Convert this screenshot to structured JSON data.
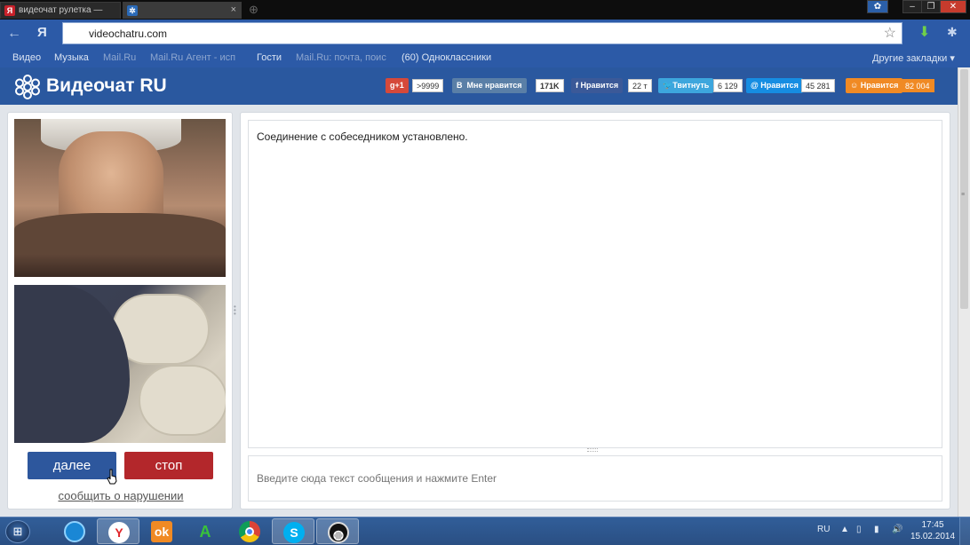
{
  "browser": {
    "tabs": [
      {
        "label": "видеочат рулетка —",
        "active": false
      },
      {
        "label": "",
        "active": true
      }
    ],
    "address": "videochatru.com",
    "yandex_letter": "Я",
    "bookmarks": [
      {
        "label": "Видео",
        "dim": false
      },
      {
        "label": "Музыка",
        "dim": false
      },
      {
        "label": "Mail.Ru",
        "dim": true
      },
      {
        "label": "Mail.Ru Агент - исп",
        "dim": true
      },
      {
        "label": "Гости",
        "dim": false
      },
      {
        "label": "Mail.Ru: почта, поис",
        "dim": true
      },
      {
        "label": "(60) Одноклассники",
        "dim": false
      }
    ],
    "other_bookmarks": "Другие закладки"
  },
  "site": {
    "title": "Видеочат RU",
    "social": [
      {
        "label": "g+1",
        "count": ">9999",
        "color": "#d5493a"
      },
      {
        "label": "Мне нравится",
        "prefix": "В",
        "count": "171K",
        "color": "#5a7fa7"
      },
      {
        "label": "Нравится",
        "prefix": "f",
        "count": "22 т",
        "color": "#3b5998"
      },
      {
        "label": "Твитнуть",
        "count": "6 129",
        "color": "#3da6dd"
      },
      {
        "label": "Нравится",
        "prefix": "@",
        "count": "45 281",
        "color": "#168de2"
      },
      {
        "label": "Нравится",
        "prefix": "ok",
        "count": "82 004",
        "color": "#f08a24"
      }
    ],
    "buttons": {
      "next": "далее",
      "stop": "стоп"
    },
    "report_link": "сообщить о нарушении",
    "chat": {
      "message": "Соединение с собеседником установлено.",
      "input_placeholder": "Введите сюда текст сообщения и нажмите Enter"
    }
  },
  "taskbar": {
    "language": "RU",
    "time": "17:45",
    "date": "15.02.2014",
    "apps": [
      "ie-icon",
      "yandex-browser-icon",
      "odnoklassniki-icon",
      "agent-icon",
      "chrome-icon",
      "skype-icon",
      "obs-icon"
    ]
  }
}
